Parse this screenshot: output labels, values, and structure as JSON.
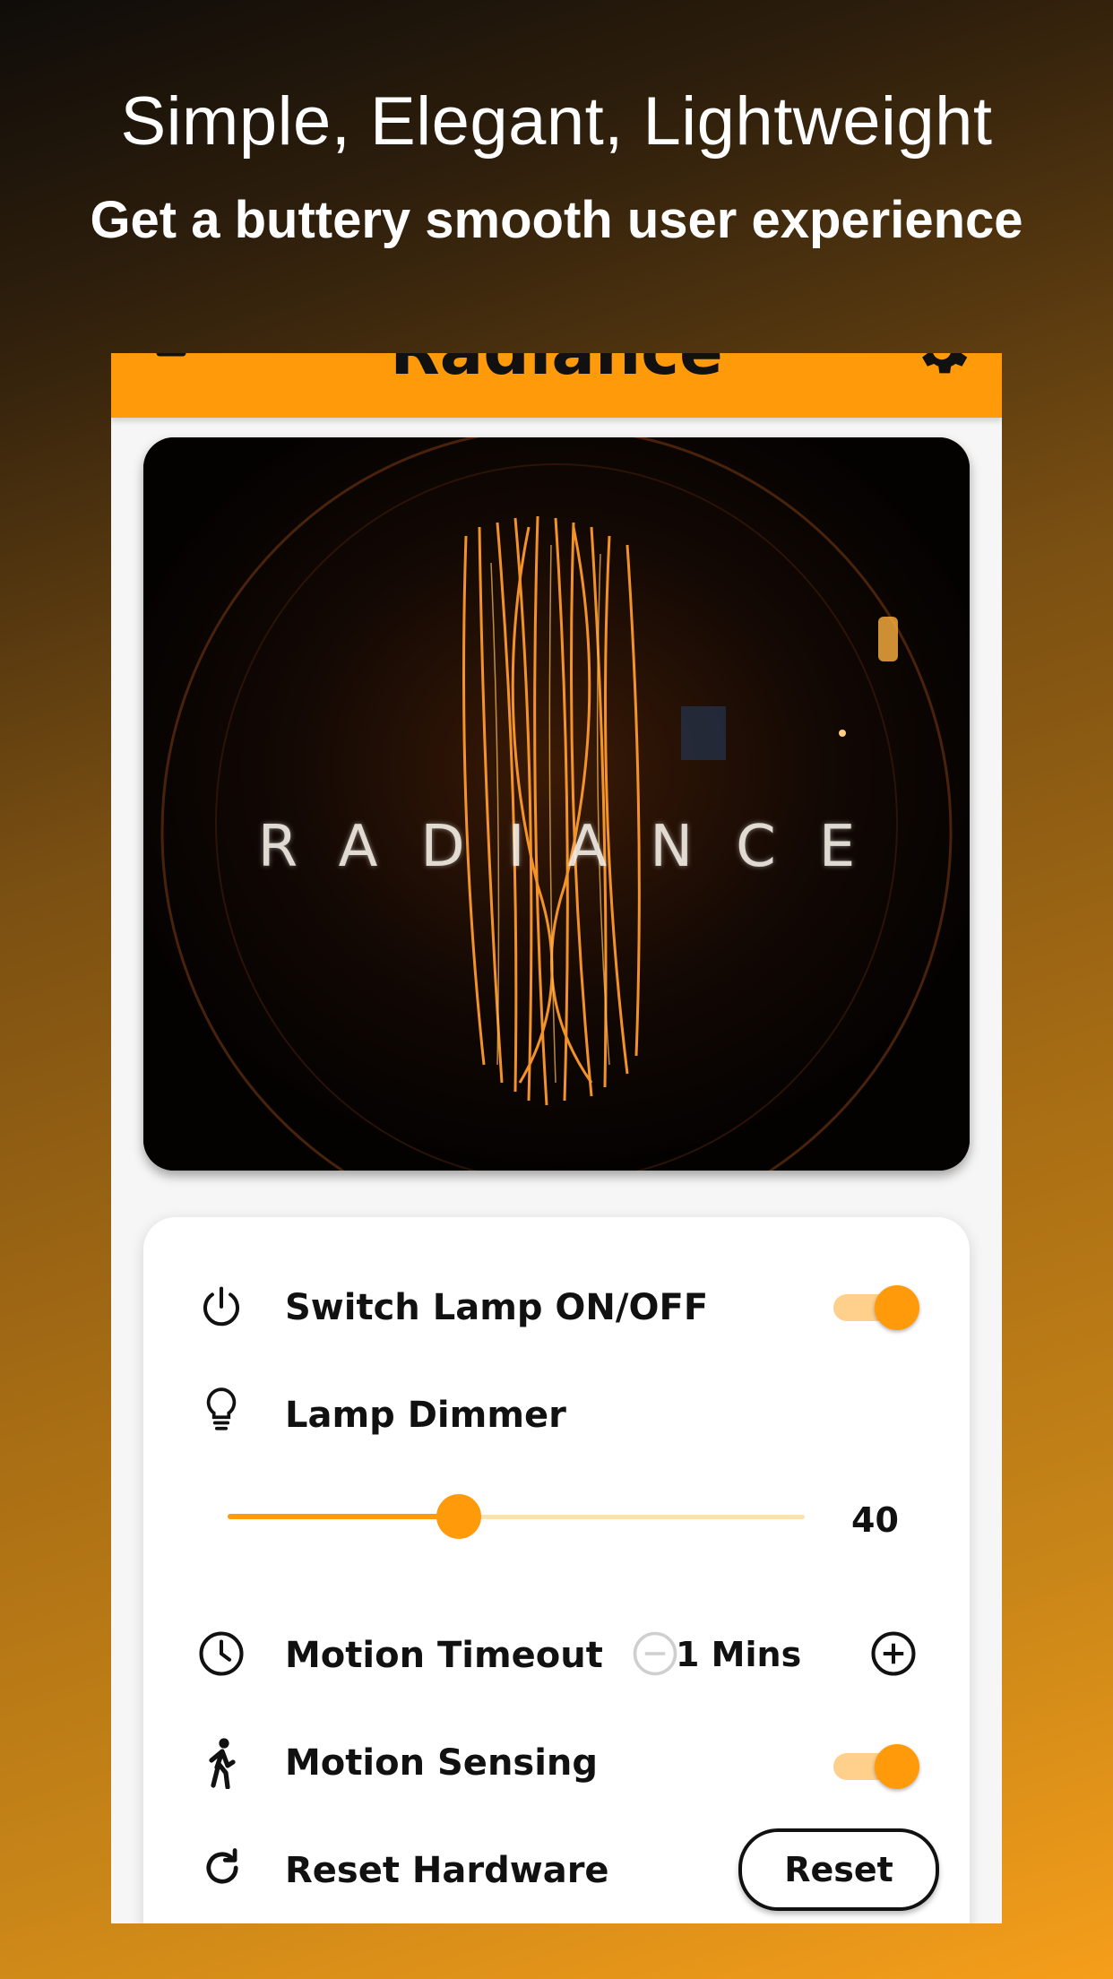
{
  "promo": {
    "title": "Simple, Elegant, Lightweight",
    "subtitle": "Get a buttery smooth user experience"
  },
  "app": {
    "title": "Radiance",
    "header_icons": [
      "back-arrow-icon",
      "gear-icon"
    ],
    "accent_color": "#ff9a0a",
    "hero": {
      "overlay_text": "RADIANCE"
    }
  },
  "controls": {
    "power": {
      "label": "Switch Lamp ON/OFF",
      "icon": "power-icon",
      "on": true
    },
    "dimmer": {
      "label": "Lamp Dimmer",
      "icon": "lightbulb-icon",
      "value": "40",
      "level_percent": 40
    },
    "timeout": {
      "label": "Motion Timeout",
      "icon": "clock-icon",
      "value": "1 Mins"
    },
    "sensing": {
      "label": "Motion Sensing",
      "icon": "walking-person-icon",
      "on": true
    },
    "reset": {
      "label": "Reset Hardware",
      "icon": "refresh-icon",
      "button_label": "Reset"
    }
  }
}
